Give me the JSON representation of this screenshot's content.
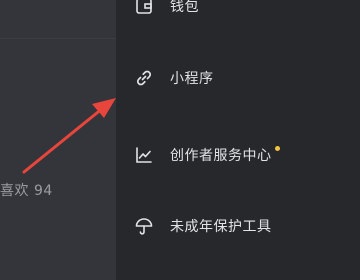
{
  "left_panel": {
    "likes_text": "喜欢 94"
  },
  "menu": {
    "items": [
      {
        "label": "钱包",
        "icon": "wallet-icon"
      },
      {
        "label": "小程序",
        "icon": "link-icon"
      },
      {
        "label": "创作者服务中心",
        "icon": "chart-icon",
        "has_dot": true
      },
      {
        "label": "未成年保护工具",
        "icon": "umbrella-icon"
      }
    ]
  },
  "annotation": {
    "arrow_color": "#e8453c"
  },
  "colors": {
    "background": "#26282c",
    "left_panel": "#33353a",
    "text": "#e2e3e6",
    "notification_dot": "#f3c443"
  }
}
